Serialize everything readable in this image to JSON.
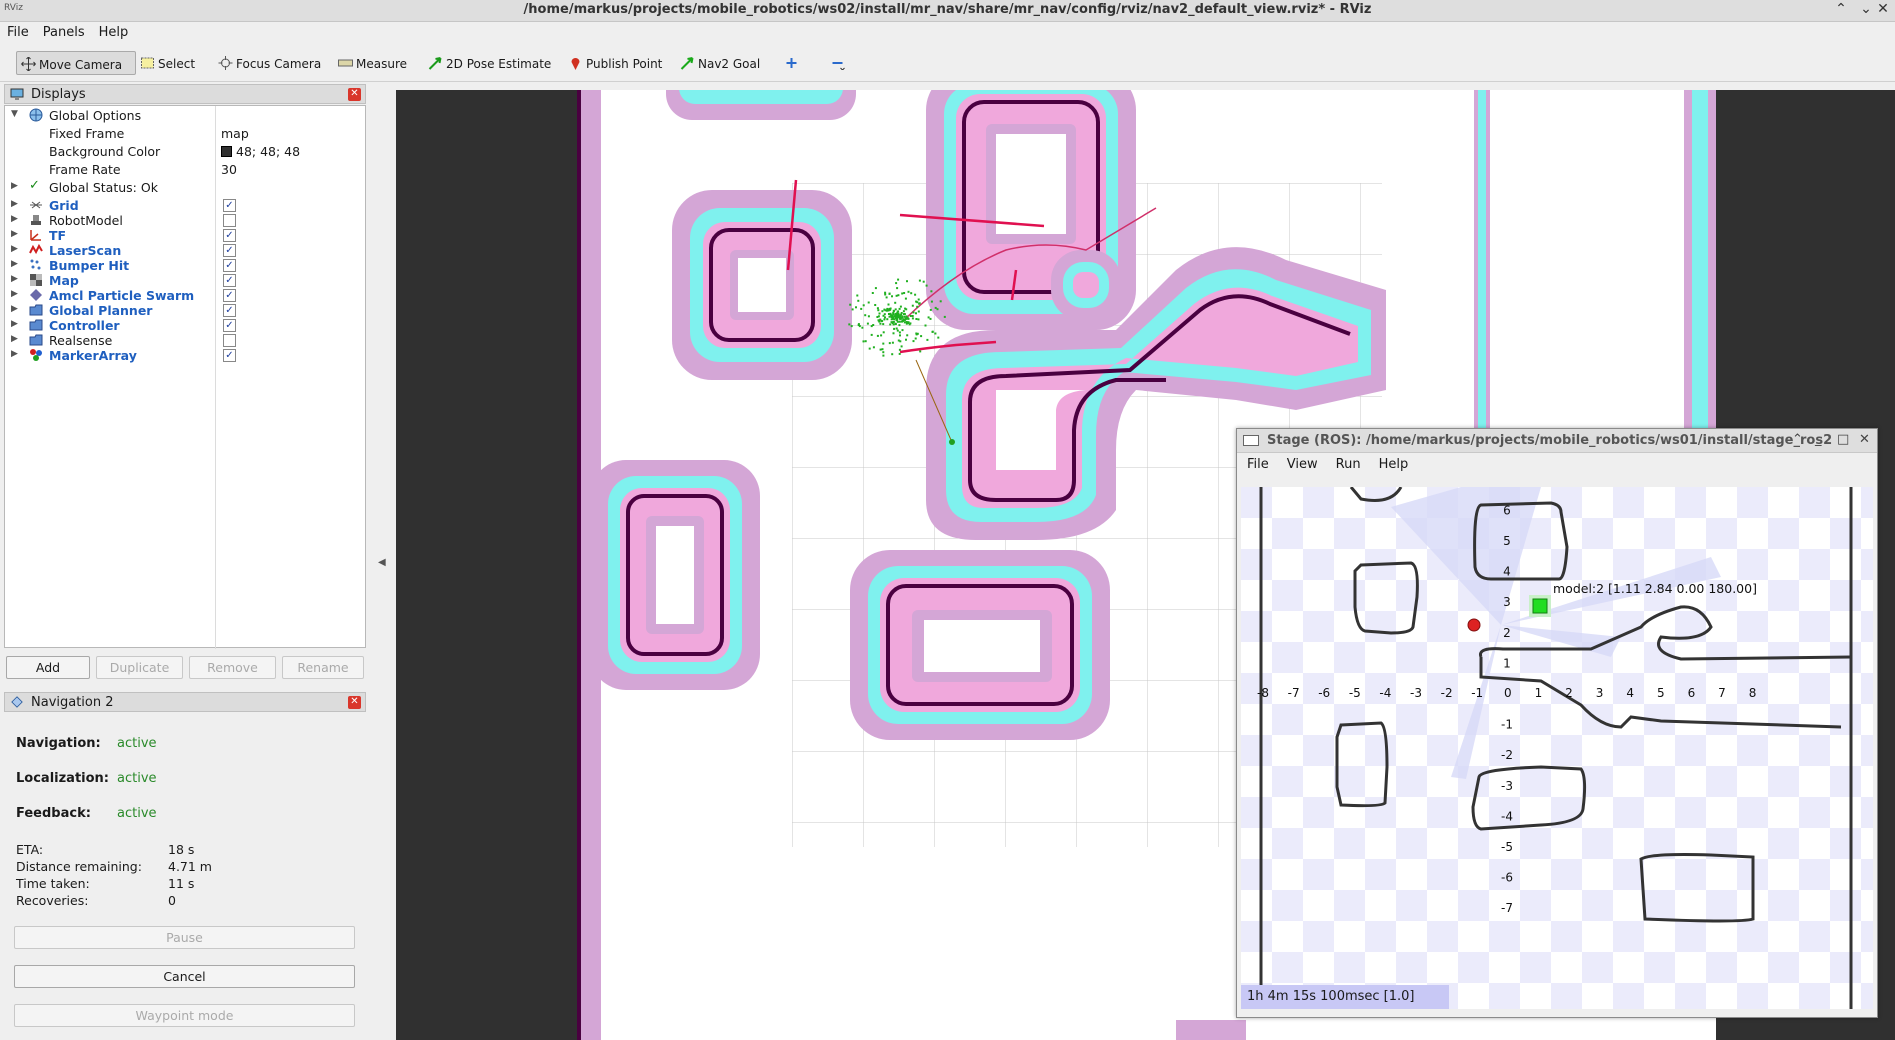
{
  "window": {
    "title": "/home/markus/projects/mobile_robotics/ws02/install/mr_nav/share/mr_nav/config/rviz/nav2_default_view.rviz* - RViz"
  },
  "menu": [
    "File",
    "Panels",
    "Help"
  ],
  "toolbar": {
    "tools": [
      {
        "label": "Move Camera",
        "icon": "move-camera-icon",
        "active": true
      },
      {
        "label": "Select",
        "icon": "select-icon"
      },
      {
        "label": "Focus Camera",
        "icon": "focus-camera-icon"
      },
      {
        "label": "Measure",
        "icon": "measure-icon"
      },
      {
        "label": "2D Pose Estimate",
        "icon": "pose-estimate-icon"
      },
      {
        "label": "Publish Point",
        "icon": "publish-point-icon"
      },
      {
        "label": "Nav2 Goal",
        "icon": "nav2-goal-icon"
      }
    ]
  },
  "displays": {
    "title": "Displays",
    "global_options": {
      "label": "Global Options",
      "fixed_frame_label": "Fixed Frame",
      "fixed_frame": "map",
      "background_color_label": "Background Color",
      "background_color": "48; 48; 48",
      "frame_rate_label": "Frame Rate",
      "frame_rate": "30"
    },
    "global_status": "Global Status: Ok",
    "items": [
      {
        "label": "Grid",
        "checked": true,
        "bold": true,
        "icon": "grid-icon"
      },
      {
        "label": "RobotModel",
        "checked": false,
        "bold": false,
        "icon": "robot-model-icon"
      },
      {
        "label": "TF",
        "checked": true,
        "bold": true,
        "icon": "tf-icon"
      },
      {
        "label": "LaserScan",
        "checked": true,
        "bold": true,
        "icon": "laser-scan-icon"
      },
      {
        "label": "Bumper Hit",
        "checked": true,
        "bold": true,
        "icon": "bumper-hit-icon"
      },
      {
        "label": "Map",
        "checked": true,
        "bold": true,
        "icon": "map-icon"
      },
      {
        "label": "Amcl Particle Swarm",
        "checked": true,
        "bold": true,
        "icon": "particle-swarm-icon"
      },
      {
        "label": "Global Planner",
        "checked": true,
        "bold": true,
        "icon": "folder-icon"
      },
      {
        "label": "Controller",
        "checked": true,
        "bold": true,
        "icon": "folder-icon"
      },
      {
        "label": "Realsense",
        "checked": false,
        "bold": false,
        "icon": "folder-icon"
      },
      {
        "label": "MarkerArray",
        "checked": true,
        "bold": true,
        "icon": "marker-array-icon"
      }
    ],
    "buttons": {
      "add": "Add",
      "duplicate": "Duplicate",
      "remove": "Remove",
      "rename": "Rename"
    }
  },
  "nav2": {
    "title": "Navigation 2",
    "navigation_label": "Navigation:",
    "navigation": "active",
    "localization_label": "Localization:",
    "localization": "active",
    "feedback_label": "Feedback:",
    "feedback": "active",
    "eta_label": "ETA:",
    "eta": "18 s",
    "distance_label": "Distance remaining:",
    "distance": "4.71 m",
    "time_label": "Time taken:",
    "time": "11 s",
    "recoveries_label": "Recoveries:",
    "recoveries": "0",
    "pause": "Pause",
    "cancel": "Cancel",
    "waypoint": "Waypoint mode"
  },
  "stage": {
    "title": "Stage (ROS): /home/markus/projects/mobile_robotics/ws01/install/stage_ros2",
    "menu": [
      "File",
      "View",
      "Run",
      "Help"
    ],
    "model_label": "model:2 [1.11 2.84 0.00 180.00]",
    "time": "1h 4m 15s 100msec [1.0]",
    "x_ticks": [
      "-8",
      "-7",
      "-6",
      "-5",
      "-4",
      "-3",
      "-2",
      "-1",
      "0",
      "1",
      "2",
      "3",
      "4",
      "5",
      "6",
      "7",
      "8"
    ],
    "y_ticks": [
      "6",
      "5",
      "4",
      "3",
      "2",
      "1",
      "-1",
      "-2",
      "-3",
      "-4",
      "-5",
      "-6",
      "-7"
    ]
  },
  "colors": {
    "background": "#303030",
    "cost_outer": "#d4a6d6",
    "cost_inner": "#7ff1ee",
    "cost_mid": "#f0a8dc",
    "wall": "#4a0040",
    "laser": "#e01050",
    "particles": "#20b020",
    "stage_robot": "#22dd22",
    "stage_obstacle": "#dd2222"
  }
}
